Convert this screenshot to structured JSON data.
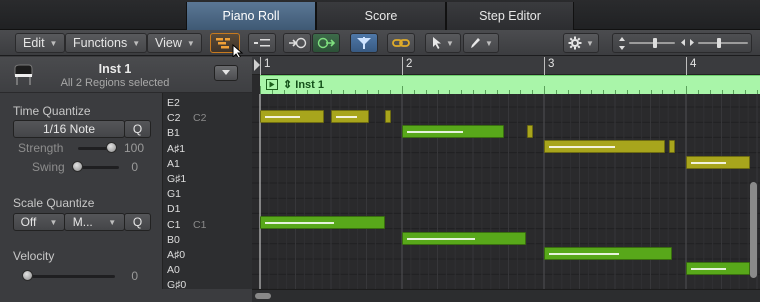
{
  "tabs": [
    {
      "label": "Piano Roll",
      "active": true
    },
    {
      "label": "Score",
      "active": false
    },
    {
      "label": "Step Editor",
      "active": false
    }
  ],
  "toolbar": {
    "edit_label": "Edit",
    "functions_label": "Functions",
    "view_label": "View"
  },
  "colors": {
    "accent_tab": "#4f6b8a",
    "note_green": "#58a81a",
    "note_yellow": "#a8a51c",
    "region_bg": "#a9f5a9",
    "selected_tool": "#c87a1e",
    "link_tool": "#d6a21e"
  },
  "track": {
    "name": "Inst 1",
    "subtitle": "All 2 Regions selected"
  },
  "time_quantize": {
    "title": "Time Quantize",
    "value": "1/16 Note",
    "q_label": "Q",
    "strength_label": "Strength",
    "strength_value": "100",
    "swing_label": "Swing",
    "swing_value": "0"
  },
  "scale_quantize": {
    "title": "Scale Quantize",
    "root": "Off",
    "mode": "M...",
    "q_label": "Q"
  },
  "velocity": {
    "title": "Velocity",
    "value": "0"
  },
  "keys": [
    {
      "note": "E2",
      "octave": ""
    },
    {
      "note": "C2",
      "octave": "C2"
    },
    {
      "note": "B1",
      "octave": ""
    },
    {
      "note": "A♯1",
      "octave": ""
    },
    {
      "note": "A1",
      "octave": ""
    },
    {
      "note": "G♯1",
      "octave": ""
    },
    {
      "note": "G1",
      "octave": ""
    },
    {
      "note": "D1",
      "octave": ""
    },
    {
      "note": "C1",
      "octave": "C1"
    },
    {
      "note": "B0",
      "octave": ""
    },
    {
      "note": "A♯0",
      "octave": ""
    },
    {
      "note": "A0",
      "octave": ""
    },
    {
      "note": "G♯0",
      "octave": ""
    }
  ],
  "ruler": {
    "bars": [
      "1",
      "2",
      "3",
      "4"
    ]
  },
  "region": {
    "name": "Inst 1"
  },
  "notes": [
    {
      "row": 1,
      "start": 1.0,
      "len": 0.45,
      "color": "yellow"
    },
    {
      "row": 1,
      "start": 1.5,
      "len": 0.27,
      "color": "yellow"
    },
    {
      "row": 1,
      "start": 1.88,
      "len": 0.04,
      "color": "yellow"
    },
    {
      "row": 2,
      "start": 2.0,
      "len": 0.72,
      "color": "green"
    },
    {
      "row": 2,
      "start": 2.88,
      "len": 0.04,
      "color": "yellow"
    },
    {
      "row": 3,
      "start": 3.0,
      "len": 0.85,
      "color": "yellow"
    },
    {
      "row": 3,
      "start": 3.88,
      "len": 0.04,
      "color": "yellow"
    },
    {
      "row": 4,
      "start": 4.0,
      "len": 0.45,
      "color": "yellow"
    },
    {
      "row": 8,
      "start": 1.0,
      "len": 0.88,
      "color": "green"
    },
    {
      "row": 9,
      "start": 2.0,
      "len": 0.87,
      "color": "green"
    },
    {
      "row": 10,
      "start": 3.0,
      "len": 0.9,
      "color": "green"
    },
    {
      "row": 11,
      "start": 4.0,
      "len": 0.45,
      "color": "green"
    }
  ]
}
